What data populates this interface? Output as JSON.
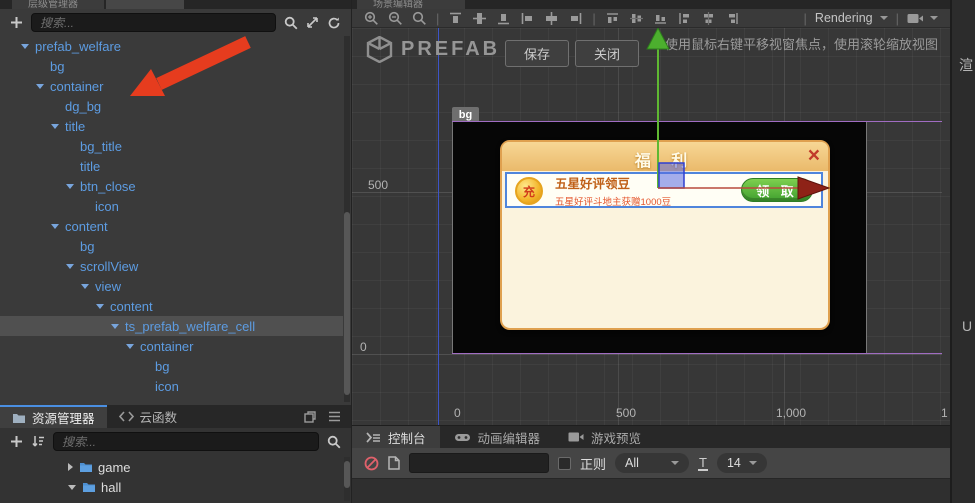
{
  "accent_colors": {
    "tree_text": "#5d9ce2",
    "selection_bg": "#505050",
    "tab_active_border": "#4a8fe2",
    "gizmo_green": "#5fb832",
    "gizmo_red": "#8e2217",
    "gizmo_blue": "rgba(90,105,225,0.55)",
    "stage_outline_purple": "#a06cc2",
    "annotation_arrow": "#e63c1e"
  },
  "hierarchy": {
    "tab_label": "层级管理器",
    "search_placeholder": "搜索...",
    "items": [
      {
        "label": "prefab_welfare",
        "level": 0,
        "expanded": true,
        "selected": false
      },
      {
        "label": "bg",
        "level": 1,
        "expanded": false,
        "selected": false
      },
      {
        "label": "container",
        "level": 1,
        "expanded": true,
        "selected": false
      },
      {
        "label": "dg_bg",
        "level": 2,
        "expanded": false,
        "selected": false
      },
      {
        "label": "title",
        "level": 2,
        "expanded": true,
        "selected": false
      },
      {
        "label": "bg_title",
        "level": 3,
        "expanded": false,
        "selected": false
      },
      {
        "label": "title",
        "level": 3,
        "expanded": false,
        "selected": false
      },
      {
        "label": "btn_close",
        "level": 3,
        "expanded": true,
        "selected": false
      },
      {
        "label": "icon",
        "level": 4,
        "expanded": false,
        "selected": false
      },
      {
        "label": "content",
        "level": 2,
        "expanded": true,
        "selected": false
      },
      {
        "label": "bg",
        "level": 3,
        "expanded": false,
        "selected": false
      },
      {
        "label": "scrollView",
        "level": 3,
        "expanded": true,
        "selected": false
      },
      {
        "label": "view",
        "level": 4,
        "expanded": true,
        "selected": false
      },
      {
        "label": "content",
        "level": 5,
        "expanded": true,
        "selected": false
      },
      {
        "label": "ts_prefab_welfare_cell",
        "level": 6,
        "expanded": true,
        "selected": true
      },
      {
        "label": "container",
        "level": 7,
        "expanded": true,
        "selected": false
      },
      {
        "label": "bg",
        "level": 8,
        "expanded": false,
        "selected": false
      },
      {
        "label": "icon",
        "level": 8,
        "expanded": false,
        "selected": false
      }
    ]
  },
  "assets": {
    "tab_assets": "资源管理器",
    "tab_cloud": "云函数",
    "search_placeholder": "搜索...",
    "items": [
      {
        "label": "game",
        "expanded": false
      },
      {
        "label": "hall",
        "expanded": true
      }
    ]
  },
  "scene": {
    "tab_label": "场景编辑器",
    "toolbar": {
      "rendering_label": "Rendering"
    },
    "prefab_logo": "PREFAB",
    "save_button": "保存",
    "close_button": "关闭",
    "hint": "使用鼠标右键平移视窗焦点，使用滚轮缩放视图",
    "bg_tag": "bg",
    "ruler": {
      "left_top": "500",
      "left_bottom": "0",
      "bottom_0": "0",
      "bottom_500": "500",
      "bottom_1000": "1,000",
      "bottom_partial": "1"
    },
    "dialog": {
      "title": "福 利",
      "close_glyph": "×",
      "coin_char": "充",
      "cell_title": "五星好评领豆",
      "cell_subtitle": "五星好评斗地主获赠1000豆",
      "claim_button": "领 取"
    }
  },
  "console": {
    "tab_console": "控制台",
    "tab_animation": "动画编辑器",
    "tab_preview": "游戏预览",
    "regex_label": "正则",
    "filter_selected": "All",
    "fontsize_selected": "14"
  },
  "inspector": {
    "fragment_top": "渲",
    "fragment_bottom": "U"
  }
}
